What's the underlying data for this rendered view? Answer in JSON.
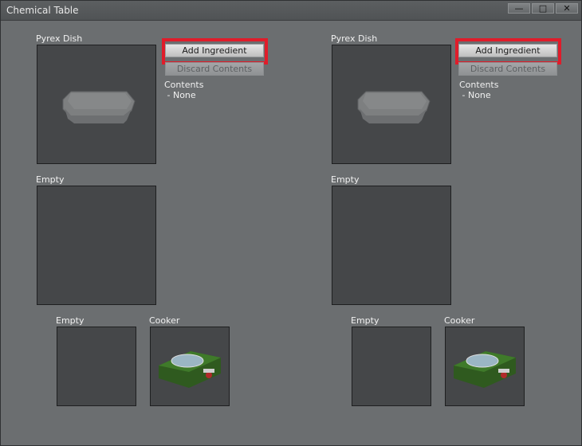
{
  "window": {
    "title": "Chemical Table",
    "controls": {
      "minimize": "—",
      "maximize": "□",
      "close": "✕"
    }
  },
  "stations": [
    {
      "dish": {
        "label": "Pyrex Dish",
        "icon": "pyrex-dish-icon"
      },
      "add_label": "Add Ingredient",
      "discard_label": "Discard Contents",
      "contents_title": "Contents",
      "contents_value": " - None",
      "slot2": {
        "label": "Empty"
      },
      "slot3": {
        "label": "Empty"
      },
      "cooker": {
        "label": "Cooker",
        "icon": "cooker-icon"
      }
    },
    {
      "dish": {
        "label": "Pyrex Dish",
        "icon": "pyrex-dish-icon"
      },
      "add_label": "Add Ingredient",
      "discard_label": "Discard Contents",
      "contents_title": "Contents",
      "contents_value": " - None",
      "slot2": {
        "label": "Empty"
      },
      "slot3": {
        "label": "Empty"
      },
      "cooker": {
        "label": "Cooker",
        "icon": "cooker-icon"
      }
    }
  ],
  "colors": {
    "highlight": "#e01c2a",
    "panel": "#6b6e70",
    "slot": "#454749"
  }
}
